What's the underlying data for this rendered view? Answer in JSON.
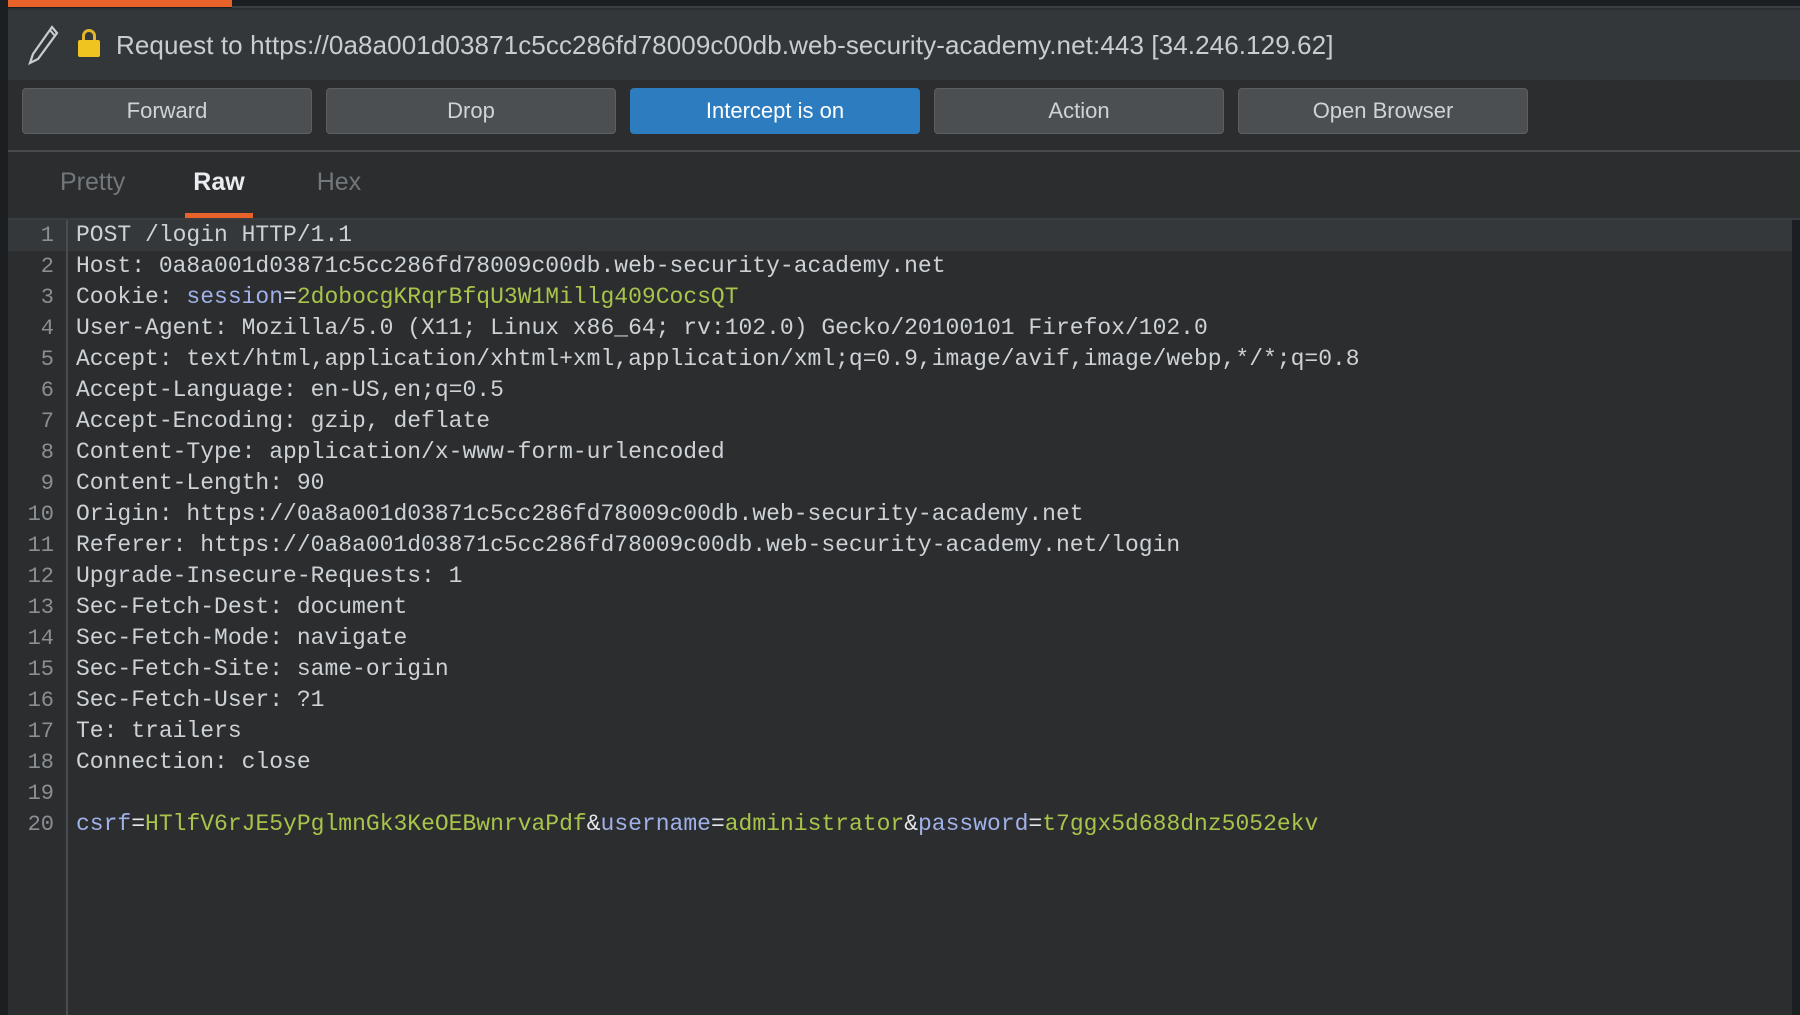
{
  "window": {
    "accent_color": "#e8622a",
    "background_color": "#2b2d2f",
    "intercept_button_color": "#2d7cc0"
  },
  "request_header": {
    "pencil_icon": "pencil-icon",
    "lock_icon": "lock-icon",
    "title": "Request to https://0a8a001d03871c5cc286fd78009c00db.web-security-academy.net:443 [34.246.129.62]",
    "host": "0a8a001d03871c5cc286fd78009c00db.web-security-academy.net",
    "port": "443",
    "ip": "34.246.129.62",
    "scheme": "https"
  },
  "toolbar": {
    "buttons": [
      {
        "label": "Forward",
        "active": false
      },
      {
        "label": "Drop",
        "active": false
      },
      {
        "label": "Intercept is on",
        "active": true
      },
      {
        "label": "Action",
        "active": false
      },
      {
        "label": "Open Browser",
        "active": false
      }
    ]
  },
  "view_tabs": {
    "items": [
      {
        "label": "Pretty",
        "active": false
      },
      {
        "label": "Raw",
        "active": true
      },
      {
        "label": "Hex",
        "active": false
      }
    ],
    "selected": "Raw"
  },
  "editor": {
    "lines": [
      {
        "n": "1",
        "tokens": [
          {
            "t": "POST /login HTTP/1.1",
            "c": "tok-name"
          }
        ]
      },
      {
        "n": "2",
        "tokens": [
          {
            "t": "Host: 0a8a001d03871c5cc286fd78009c00db.web-security-academy.net",
            "c": "tok-name"
          }
        ]
      },
      {
        "n": "3",
        "tokens": [
          {
            "t": "Cookie: ",
            "c": "tok-name"
          },
          {
            "t": "session",
            "c": "tok-key"
          },
          {
            "t": "=",
            "c": "tok-eq"
          },
          {
            "t": "2dobocgKRqrBfqU3W1Millg409CocsQT",
            "c": "tok-val"
          }
        ]
      },
      {
        "n": "4",
        "tokens": [
          {
            "t": "User-Agent: Mozilla/5.0 (X11; Linux x86_64; rv:102.0) Gecko/20100101 Firefox/102.0",
            "c": "tok-name"
          }
        ]
      },
      {
        "n": "5",
        "tokens": [
          {
            "t": "Accept: text/html,application/xhtml+xml,application/xml;q=0.9,image/avif,image/webp,*/*;q=0.8",
            "c": "tok-name"
          }
        ]
      },
      {
        "n": "6",
        "tokens": [
          {
            "t": "Accept-Language: en-US,en;q=0.5",
            "c": "tok-name"
          }
        ]
      },
      {
        "n": "7",
        "tokens": [
          {
            "t": "Accept-Encoding: gzip, deflate",
            "c": "tok-name"
          }
        ]
      },
      {
        "n": "8",
        "tokens": [
          {
            "t": "Content-Type: application/x-www-form-urlencoded",
            "c": "tok-name"
          }
        ]
      },
      {
        "n": "9",
        "tokens": [
          {
            "t": "Content-Length: 90",
            "c": "tok-name"
          }
        ]
      },
      {
        "n": "10",
        "tokens": [
          {
            "t": "Origin: https://0a8a001d03871c5cc286fd78009c00db.web-security-academy.net",
            "c": "tok-name"
          }
        ]
      },
      {
        "n": "11",
        "tokens": [
          {
            "t": "Referer: https://0a8a001d03871c5cc286fd78009c00db.web-security-academy.net/login",
            "c": "tok-name"
          }
        ]
      },
      {
        "n": "12",
        "tokens": [
          {
            "t": "Upgrade-Insecure-Requests: 1",
            "c": "tok-name"
          }
        ]
      },
      {
        "n": "13",
        "tokens": [
          {
            "t": "Sec-Fetch-Dest: document",
            "c": "tok-name"
          }
        ]
      },
      {
        "n": "14",
        "tokens": [
          {
            "t": "Sec-Fetch-Mode: navigate",
            "c": "tok-name"
          }
        ]
      },
      {
        "n": "15",
        "tokens": [
          {
            "t": "Sec-Fetch-Site: same-origin",
            "c": "tok-name"
          }
        ]
      },
      {
        "n": "16",
        "tokens": [
          {
            "t": "Sec-Fetch-User: ?1",
            "c": "tok-name"
          }
        ]
      },
      {
        "n": "17",
        "tokens": [
          {
            "t": "Te: trailers",
            "c": "tok-name"
          }
        ]
      },
      {
        "n": "18",
        "tokens": [
          {
            "t": "Connection: close",
            "c": "tok-name"
          }
        ]
      },
      {
        "n": "19",
        "tokens": [
          {
            "t": "",
            "c": "tok-name"
          }
        ]
      },
      {
        "n": "20",
        "tokens": [
          {
            "t": "csrf",
            "c": "tok-key"
          },
          {
            "t": "=",
            "c": "tok-eq"
          },
          {
            "t": "HTlfV6rJE5yPglmnGk3KeOEBwnrvaPdf",
            "c": "tok-val"
          },
          {
            "t": "&",
            "c": "tok-eq"
          },
          {
            "t": "username",
            "c": "tok-key"
          },
          {
            "t": "=",
            "c": "tok-eq"
          },
          {
            "t": "administrator",
            "c": "tok-val"
          },
          {
            "t": "&",
            "c": "tok-eq"
          },
          {
            "t": "password",
            "c": "tok-key"
          },
          {
            "t": "=",
            "c": "tok-eq"
          },
          {
            "t": "t7ggx5d688dnz5052ekv",
            "c": "tok-val"
          }
        ]
      }
    ]
  }
}
